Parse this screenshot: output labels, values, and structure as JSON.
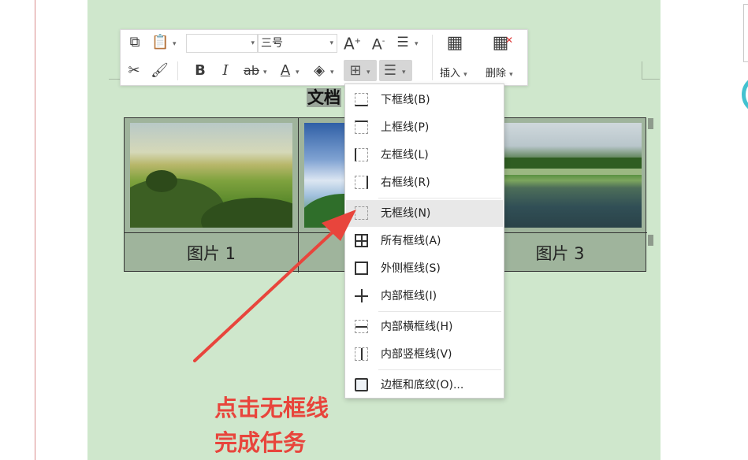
{
  "document": {
    "title_fragment": "文档",
    "captions": [
      "图片 1",
      "图片 3"
    ]
  },
  "toolbar": {
    "font_name": "",
    "font_size": "三号",
    "bold": "B",
    "italic": "I",
    "grow_font": "A",
    "shrink_font": "A",
    "insert_label": "插入",
    "delete_label": "删除"
  },
  "border_menu": {
    "highlighted": "无框线(N)",
    "items": [
      {
        "label": "下框线(B)",
        "icon": "border-bottom-icon"
      },
      {
        "label": "上框线(P)",
        "icon": "border-top-icon"
      },
      {
        "label": "左框线(L)",
        "icon": "border-left-icon"
      },
      {
        "label": "右框线(R)",
        "icon": "border-right-icon"
      },
      {
        "label": "无框线(N)",
        "icon": "border-none-icon"
      },
      {
        "label": "所有框线(A)",
        "icon": "border-all-icon"
      },
      {
        "label": "外侧框线(S)",
        "icon": "border-outside-icon"
      },
      {
        "label": "内部框线(I)",
        "icon": "border-inside-icon"
      },
      {
        "label": "内部横框线(H)",
        "icon": "border-inside-horizontal-icon"
      },
      {
        "label": "内部竖框线(V)",
        "icon": "border-inside-vertical-icon"
      },
      {
        "label": "边框和底纹(O)...",
        "icon": "borders-shading-icon"
      }
    ]
  },
  "annotation": {
    "line1": "点击无框线",
    "line2": "完成任务",
    "color": "#e8453c"
  }
}
